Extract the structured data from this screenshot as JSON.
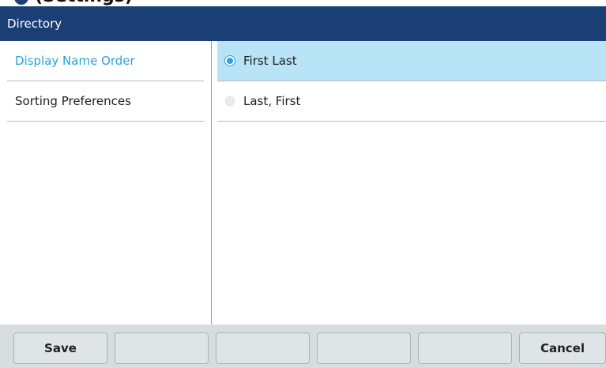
{
  "header": {
    "page_title_fragment": "(Settings)",
    "title": "Directory"
  },
  "menu": {
    "items": [
      {
        "label": "Display Name Order",
        "selected": true
      },
      {
        "label": "Sorting Preferences",
        "selected": false
      }
    ]
  },
  "options": {
    "items": [
      {
        "label": "First Last",
        "selected": true
      },
      {
        "label": "Last, First",
        "selected": false
      }
    ]
  },
  "softkeys": {
    "save_label": "Save",
    "key2_label": "",
    "key3_label": "",
    "key4_label": "",
    "key5_label": "",
    "cancel_label": "Cancel"
  },
  "colors": {
    "titlebar": "#1b3f75",
    "accent": "#2aa3d8",
    "selected_row": "#b9e3f6",
    "softkey_bar": "#d7dddf"
  },
  "icons": {
    "settings_icon": "gear-icon"
  }
}
